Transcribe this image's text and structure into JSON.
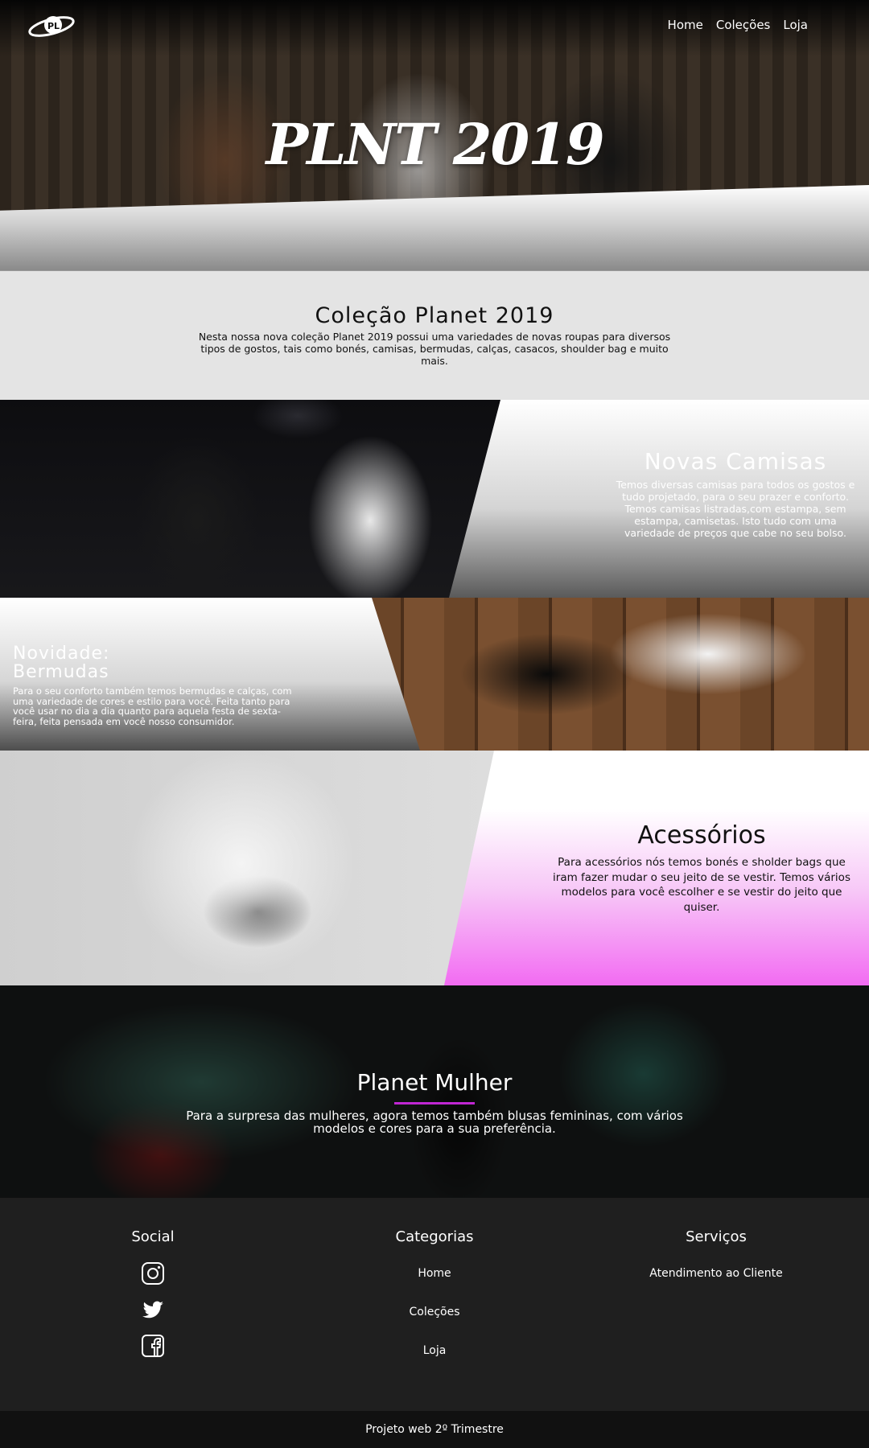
{
  "header": {
    "logo_icon": "planet-logo-icon",
    "nav": [
      "Home",
      "Coleções",
      "Loja"
    ],
    "hero_title": "PLNT 2019"
  },
  "collection": {
    "title": "Coleção Planet 2019",
    "text": "Nesta nossa nova coleção Planet 2019 possui uma variedades de novas roupas para diversos tipos de gostos, tais como bonés, camisas, bermudas, calças, casacos, shoulder bag e muito mais."
  },
  "shirts": {
    "title": "Novas Camisas",
    "text": "Temos diversas camisas para todos os gostos e tudo projetado, para o seu prazer e conforto. Temos camisas listradas,com estampa, sem estampa, camisetas. Isto tudo com uma variedade de preços que cabe no seu bolso."
  },
  "shorts": {
    "title_line1": "Novidade:",
    "title_line2": "Bermudas",
    "text": "Para o seu conforto também temos bermudas e calças, com uma variedade de cores e estilo para você. Feita tanto para você usar no dia a dia quanto para aquela festa de sexta-feira, feita pensada em você nosso consumidor."
  },
  "accessories": {
    "title": "Acessórios",
    "text": "Para acessórios nós temos bonés e sholder bags que iram fazer mudar o seu jeito de se vestir. Temos vários modelos para você escolher e se vestir do jeito que quiser."
  },
  "women": {
    "title": "Planet Mulher",
    "text": "Para a surpresa das mulheres, agora temos também blusas femininas, com vários modelos e cores para a sua preferência.",
    "accent_color": "#c026d3"
  },
  "footer": {
    "social_title": "Social",
    "social_icons": [
      "instagram-icon",
      "twitter-icon",
      "facebook-icon"
    ],
    "categories_title": "Categorias",
    "categories": [
      "Home",
      "Coleções",
      "Loja"
    ],
    "services_title": "Serviços",
    "services": [
      "Atendimento ao Cliente"
    ],
    "bottom_text": "Projeto web 2º Trimestre"
  },
  "accent_pink": "#f26bf2"
}
